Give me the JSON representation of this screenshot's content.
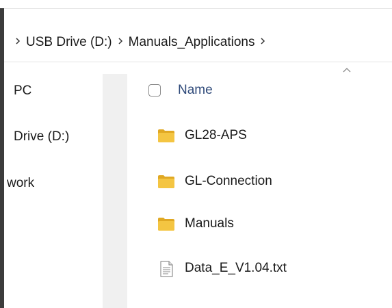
{
  "breadcrumb": {
    "items": [
      "USB Drive (D:)",
      "Manuals_Applications"
    ]
  },
  "nav": {
    "items": [
      "PC",
      "Drive (D:)",
      "work"
    ]
  },
  "header": {
    "name_label": "Name"
  },
  "files": [
    {
      "name": "GL28-APS",
      "icon": "folder-icon"
    },
    {
      "name": "GL-Connection",
      "icon": "folder-icon"
    },
    {
      "name": "Manuals",
      "icon": "folder-icon"
    },
    {
      "name": "Data_E_V1.04.txt",
      "icon": "text-file-icon"
    }
  ],
  "colors": {
    "folder": "#f4c542",
    "folder_dark": "#e0a823",
    "header_text": "#2f4a7a"
  }
}
